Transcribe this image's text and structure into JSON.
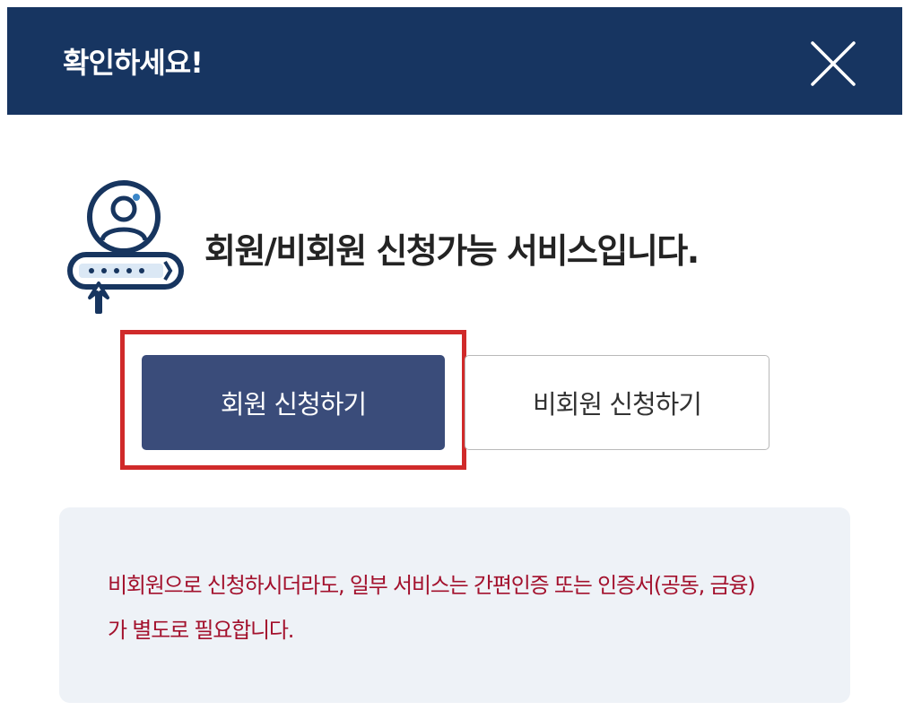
{
  "dialog": {
    "title": "확인하세요!",
    "close_icon": "close-icon"
  },
  "info": {
    "icon": "member-login-icon",
    "headline": "회원/비회원 신청가능 서비스입니다."
  },
  "buttons": {
    "member_label": "회원 신청하기",
    "guest_label": "비회원 신청하기"
  },
  "notice": {
    "line1": "비회원으로 신청하시더라도, 일부 서비스는 간편인증 또는 인증서(공동, 금융)",
    "line2": "가 별도로 필요합니다."
  },
  "colors": {
    "header_bg": "#173561",
    "primary_button": "#3a4c7a",
    "highlight_border": "#d02a2a",
    "notice_bg": "#eef2f7",
    "notice_text": "#a3112d"
  }
}
